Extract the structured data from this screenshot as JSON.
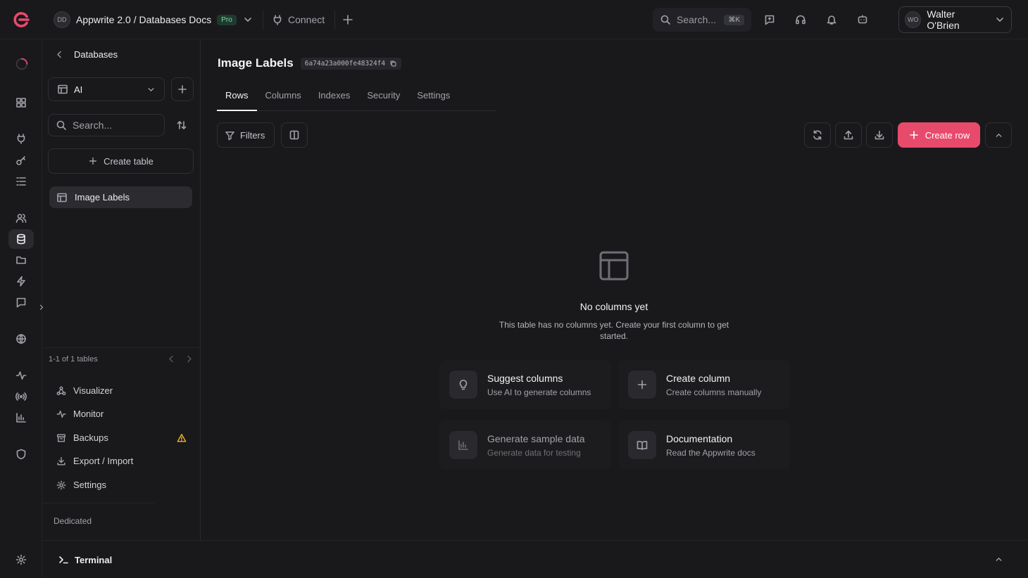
{
  "brand": {
    "accent": "#e84a6c"
  },
  "topbar": {
    "project_initials": "DD",
    "project_name": "Appwrite 2.0 / Databases Docs",
    "plan_badge": "Pro",
    "connect_label": "Connect",
    "search_placeholder": "Search...",
    "search_shortcut": "⌘K",
    "user_initials": "WO",
    "user_name": "Walter O'Brien"
  },
  "sidebar": {
    "back_label": "Databases",
    "database_selected": "AI",
    "search_placeholder": "Search...",
    "create_table_label": "Create table",
    "tables": [
      {
        "label": "Image Labels"
      }
    ],
    "pagination": "1-1 of 1 tables",
    "nav": [
      {
        "label": "Visualizer",
        "icon": "visualizer-icon"
      },
      {
        "label": "Monitor",
        "icon": "monitor-icon"
      },
      {
        "label": "Backups",
        "icon": "backups-icon",
        "warning": true
      },
      {
        "label": "Export / Import",
        "icon": "export-import-icon"
      },
      {
        "label": "Settings",
        "icon": "settings-icon"
      }
    ],
    "footer_label": "Dedicated"
  },
  "main": {
    "title": "Image Labels",
    "table_id": "6a74a23a000fe48324f4",
    "tabs": [
      {
        "label": "Rows",
        "active": true
      },
      {
        "label": "Columns"
      },
      {
        "label": "Indexes"
      },
      {
        "label": "Security"
      },
      {
        "label": "Settings"
      }
    ],
    "filters_label": "Filters",
    "create_row_label": "Create row",
    "empty_state": {
      "title": "No columns yet",
      "description": "This table has no columns yet. Create your first column to get started."
    },
    "cards": [
      {
        "title": "Suggest columns",
        "desc": "Use AI to generate columns",
        "icon": "lightbulb-icon"
      },
      {
        "title": "Create column",
        "desc": "Create columns manually",
        "icon": "plus-icon"
      },
      {
        "title": "Generate sample data",
        "desc": "Generate data for testing",
        "icon": "chart-icon",
        "disabled": true
      },
      {
        "title": "Documentation",
        "desc": "Read the Appwrite docs",
        "icon": "book-icon"
      }
    ]
  },
  "terminal": {
    "label": "Terminal"
  }
}
